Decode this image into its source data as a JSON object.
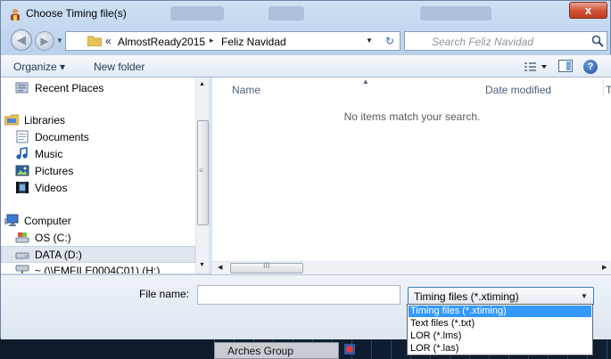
{
  "window": {
    "title": "Choose Timing file(s)",
    "close_label": "x"
  },
  "address": {
    "overflow": "«",
    "crumbs": [
      "AlmostReady2015",
      "Feliz Navidad"
    ],
    "separator": "▸"
  },
  "search": {
    "placeholder": "Search Feliz Navidad"
  },
  "toolbar": {
    "organize": "Organize ▾",
    "new_folder": "New folder",
    "help": "?"
  },
  "nav": {
    "items": [
      {
        "label": "Recent Places",
        "icon": "recent-places-icon"
      },
      {
        "label": "Libraries",
        "icon": "libraries-icon"
      },
      {
        "label": "Documents",
        "icon": "documents-icon"
      },
      {
        "label": "Music",
        "icon": "music-icon"
      },
      {
        "label": "Pictures",
        "icon": "pictures-icon"
      },
      {
        "label": "Videos",
        "icon": "videos-icon"
      },
      {
        "label": "Computer",
        "icon": "computer-icon"
      },
      {
        "label": "OS (C:)",
        "icon": "os-drive-icon"
      },
      {
        "label": "DATA (D:)",
        "icon": "data-drive-icon",
        "selected": true
      },
      {
        "label": "~ (\\\\EMFILE0004C01) (H:)",
        "icon": "network-drive-icon"
      }
    ]
  },
  "content": {
    "columns": [
      "Name",
      "Date modified",
      "T"
    ],
    "empty_message": "No items match your search."
  },
  "scroll": {
    "grip": "≡",
    "h_grip": "III"
  },
  "footer": {
    "file_name_label": "File name:",
    "file_name_value": "",
    "file_type_selected": "Timing files (*.xtiming)",
    "file_type_options": [
      "Timing files (*.xtiming)",
      "Text files (*.txt)",
      "LOR (*.lms)",
      "LOR (*.las)"
    ]
  },
  "background": {
    "label": "Arches Group"
  },
  "colors": {
    "highlight": "#3399ff",
    "close": "#c13d22",
    "window_chrome": "#b9d1ec"
  }
}
